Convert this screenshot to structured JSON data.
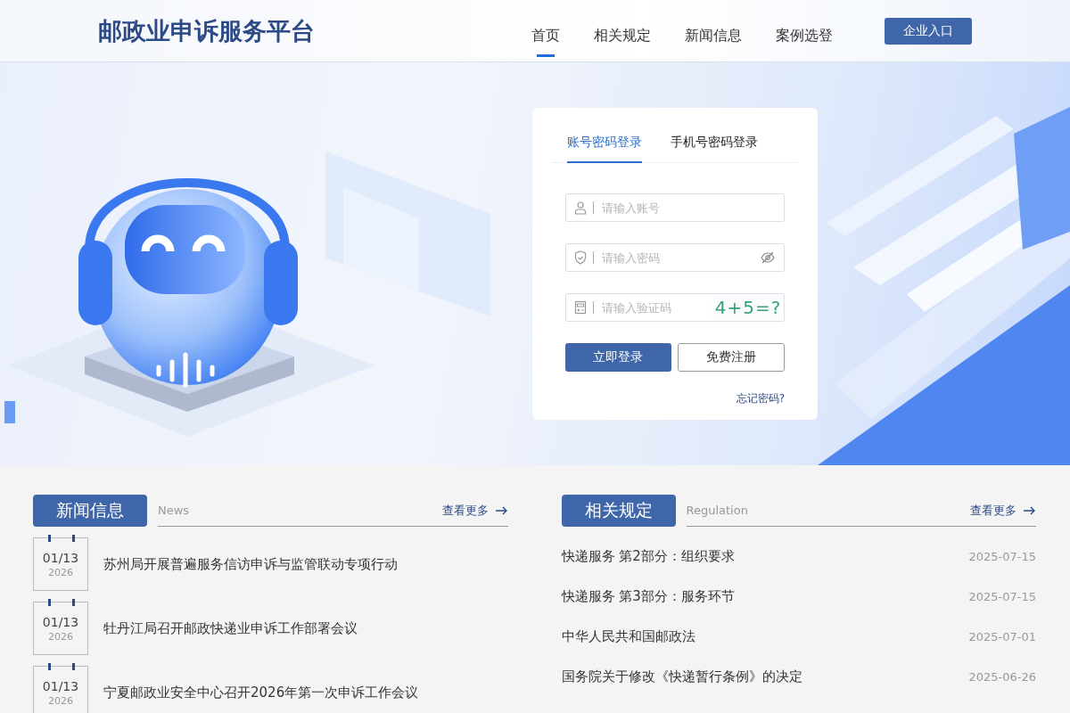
{
  "header": {
    "title": "邮政业申诉服务平台",
    "nav": [
      {
        "label": "首页",
        "selected": true
      },
      {
        "label": "相关规定",
        "selected": false
      },
      {
        "label": "新闻信息",
        "selected": false
      },
      {
        "label": "案例选登",
        "selected": false
      }
    ],
    "enterprise_button": "企业入口"
  },
  "login": {
    "tabs": [
      {
        "label": "账号密码登录",
        "selected": true
      },
      {
        "label": "手机号密码登录",
        "selected": false
      }
    ],
    "fields": [
      {
        "kind": "account",
        "placeholder": "请输入账号"
      },
      {
        "kind": "password",
        "placeholder": "请输入密码"
      },
      {
        "kind": "captcha",
        "placeholder": "请输入验证码",
        "captcha": "4+5=?"
      }
    ],
    "login_button": "立即登录",
    "register_button": "免费注册",
    "forgot_link": "忘记密码?"
  },
  "news": {
    "title": "新闻信息",
    "subtitle": "News",
    "more": "查看更多",
    "items": [
      {
        "date": "01/13",
        "year": "2026",
        "title": "苏州局开展普遍服务信访申诉与监管联动专项行动"
      },
      {
        "date": "01/13",
        "year": "2026",
        "title": "牡丹江局召开邮政快递业申诉工作部署会议"
      },
      {
        "date": "01/13",
        "year": "2026",
        "title": "宁夏邮政业安全中心召开2026年第一次申诉工作会议"
      }
    ]
  },
  "regulations": {
    "title": "相关规定",
    "subtitle": "Regulation",
    "more": "查看更多",
    "items": [
      {
        "title": "快递服务 第2部分：组织要求",
        "date": "2025-07-15"
      },
      {
        "title": "快递服务 第3部分：服务环节",
        "date": "2025-07-15"
      },
      {
        "title": "中华人民共和国邮政法",
        "date": "2025-07-01"
      },
      {
        "title": "国务院关于修改《快递暂行条例》的决定",
        "date": "2025-06-26"
      }
    ]
  }
}
